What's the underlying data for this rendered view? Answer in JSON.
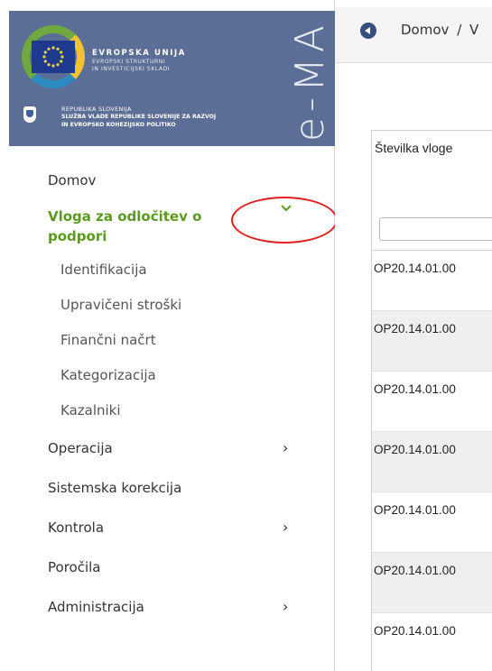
{
  "brand": {
    "eu_line1": "EVROPSKA UNIJA",
    "eu_line2": "EVROPSKI STRUKTURNI",
    "eu_line3": "IN INVESTICIJSKI SKLADI",
    "gov_line1": "REPUBLIKA SLOVENIJA",
    "gov_line2": "SLUŽBA VLADE REPUBLIKE SLOVENIJE ZA RAZVOJ",
    "gov_line3": "IN EVROPSKO KOHEZIJSKO POLITIKO",
    "app_name": "e-MA"
  },
  "nav": {
    "home": "Domov",
    "active": "Vloga za odločitev o podpori",
    "sub_items": [
      "Identifikacija",
      "Upravičeni stroški",
      "Finančni načrt",
      "Kategorizacija",
      "Kazalniki"
    ],
    "operacija": "Operacija",
    "sistemska": "Sistemska korekcija",
    "kontrola": "Kontrola",
    "porocila": "Poročila",
    "administracija": "Administracija"
  },
  "breadcrumb": {
    "home": "Domov",
    "separator": "/",
    "next": "V"
  },
  "table": {
    "column_header": "Številka vloge",
    "filter_value": "",
    "rows": [
      "OP20.14.01.00",
      "OP20.14.01.00",
      "OP20.14.01.00",
      "OP20.14.01.00",
      "OP20.14.01.00",
      "OP20.14.01.00",
      "OP20.14.01.00"
    ]
  },
  "icons": {
    "back": "arrow-left-circle-icon",
    "expanded": "chevron-down-icon",
    "collapsed": "chevron-right-icon"
  },
  "colors": {
    "brand_bg": "#5b6e95",
    "active_green": "#5a9a1f",
    "annotation_red": "#e02020"
  }
}
